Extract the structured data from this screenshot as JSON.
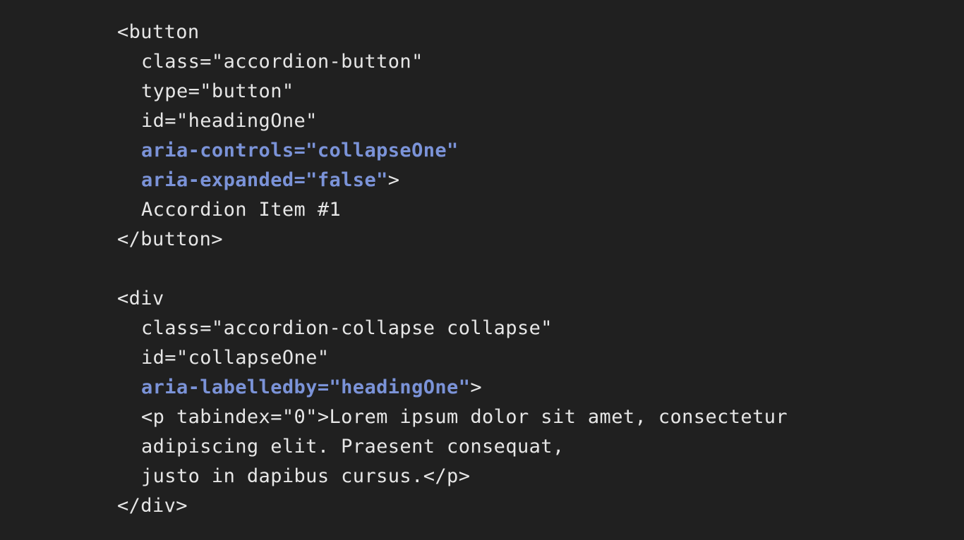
{
  "colors": {
    "background": "#202020",
    "text": "#e6e6e6",
    "highlight": "#7b93d8"
  },
  "code": {
    "lines": [
      {
        "indent": 0,
        "segments": [
          {
            "text": "<button",
            "highlight": false
          }
        ]
      },
      {
        "indent": 1,
        "segments": [
          {
            "text": "class=\"accordion-button\"",
            "highlight": false
          }
        ]
      },
      {
        "indent": 1,
        "segments": [
          {
            "text": "type=\"button\"",
            "highlight": false
          }
        ]
      },
      {
        "indent": 1,
        "segments": [
          {
            "text": "id=\"headingOne\"",
            "highlight": false
          }
        ]
      },
      {
        "indent": 1,
        "segments": [
          {
            "text": "aria-controls=\"collapseOne\"",
            "highlight": true
          }
        ]
      },
      {
        "indent": 1,
        "segments": [
          {
            "text": "aria-expanded=\"false\"",
            "highlight": true
          },
          {
            "text": ">",
            "highlight": false
          }
        ]
      },
      {
        "indent": 1,
        "segments": [
          {
            "text": "Accordion Item #1",
            "highlight": false
          }
        ]
      },
      {
        "indent": 0,
        "segments": [
          {
            "text": "</button>",
            "highlight": false
          }
        ]
      },
      {
        "indent": 0,
        "segments": []
      },
      {
        "indent": 0,
        "segments": [
          {
            "text": "<div",
            "highlight": false
          }
        ]
      },
      {
        "indent": 1,
        "segments": [
          {
            "text": "class=\"accordion-collapse collapse\"",
            "highlight": false
          }
        ]
      },
      {
        "indent": 1,
        "segments": [
          {
            "text": "id=\"collapseOne\"",
            "highlight": false
          }
        ]
      },
      {
        "indent": 1,
        "segments": [
          {
            "text": "aria-labelledby=\"headingOne\"",
            "highlight": true
          },
          {
            "text": ">",
            "highlight": false
          }
        ]
      },
      {
        "indent": 1,
        "segments": [
          {
            "text": "<p tabindex=\"0\">Lorem ipsum dolor sit amet, consectetur",
            "highlight": false
          }
        ]
      },
      {
        "indent": 1,
        "segments": [
          {
            "text": "adipiscing elit. Praesent consequat,",
            "highlight": false
          }
        ]
      },
      {
        "indent": 1,
        "segments": [
          {
            "text": "justo in dapibus cursus.</p>",
            "highlight": false
          }
        ]
      },
      {
        "indent": 0,
        "segments": [
          {
            "text": "</div>",
            "highlight": false
          }
        ]
      }
    ]
  }
}
